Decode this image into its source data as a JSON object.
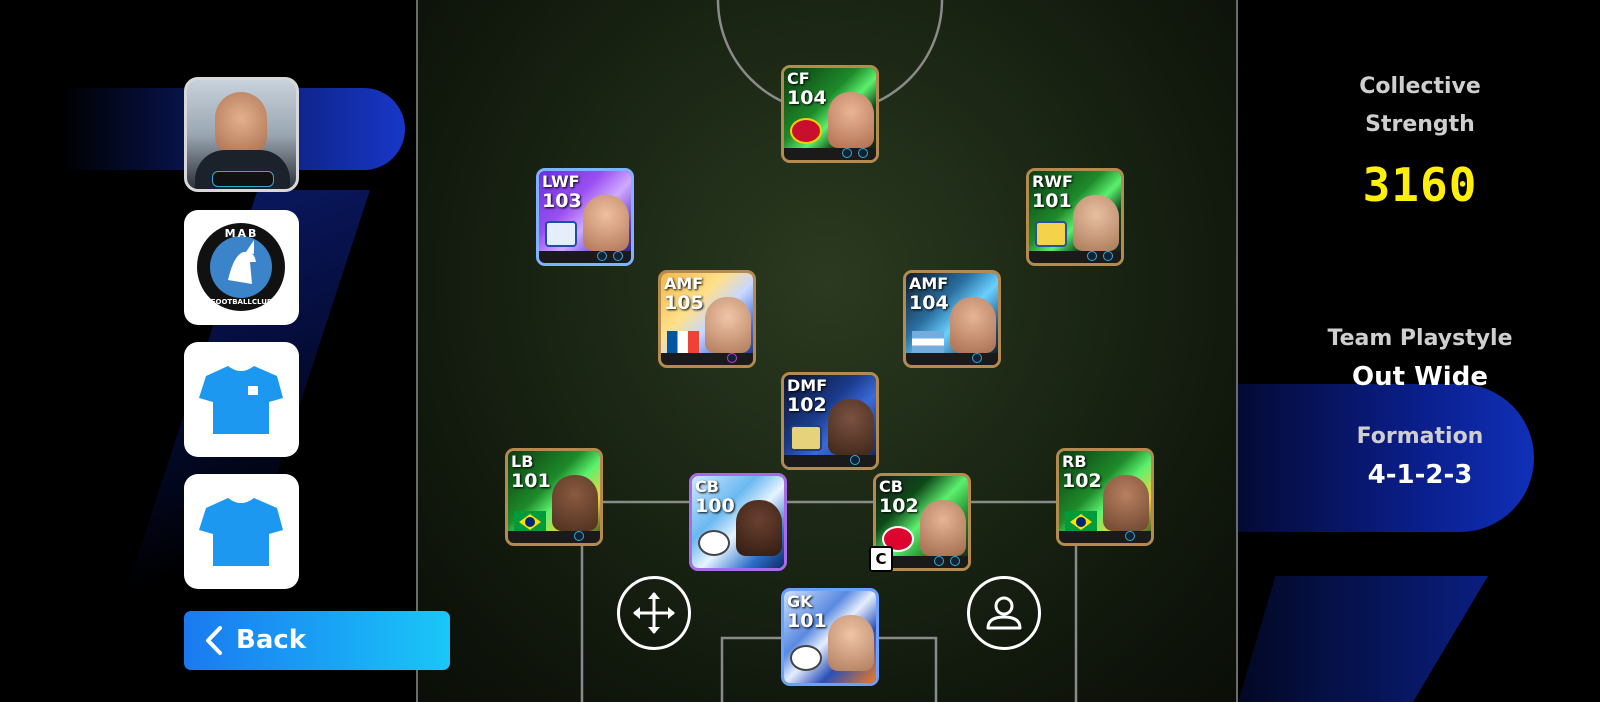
{
  "colors": {
    "accent_blue": "#1a90ff",
    "strength_yellow": "#ffef0a",
    "card_border": "#b58a4f"
  },
  "manager": {
    "icon": "manager-avatar"
  },
  "club": {
    "logo_text_top": "MAB",
    "logo_text_bottom": "FOOTBALLCLUB"
  },
  "kits": [
    {
      "icon": "home-kit-icon"
    },
    {
      "icon": "away-kit-icon"
    }
  ],
  "back_button": {
    "label": "Back",
    "icon": "chevron-left-icon"
  },
  "players": [
    {
      "pos": "CF",
      "rating": "104"
    },
    {
      "pos": "LWF",
      "rating": "103"
    },
    {
      "pos": "RWF",
      "rating": "101"
    },
    {
      "pos": "AMF",
      "rating": "105"
    },
    {
      "pos": "AMF",
      "rating": "104"
    },
    {
      "pos": "DMF",
      "rating": "102"
    },
    {
      "pos": "LB",
      "rating": "101"
    },
    {
      "pos": "CB",
      "rating": "100"
    },
    {
      "pos": "CB",
      "rating": "102",
      "captain": "C"
    },
    {
      "pos": "RB",
      "rating": "102"
    },
    {
      "pos": "GK",
      "rating": "101"
    }
  ],
  "controls": {
    "move_icon": "move-arrows-icon",
    "player_icon": "person-icon"
  },
  "stats": {
    "collective_label_1": "Collective",
    "collective_label_2": "Strength",
    "collective_value": "3160",
    "playstyle_label": "Team Playstyle",
    "playstyle_value": "Out Wide",
    "formation_label": "Formation",
    "formation_value": "4-1-2-3"
  }
}
